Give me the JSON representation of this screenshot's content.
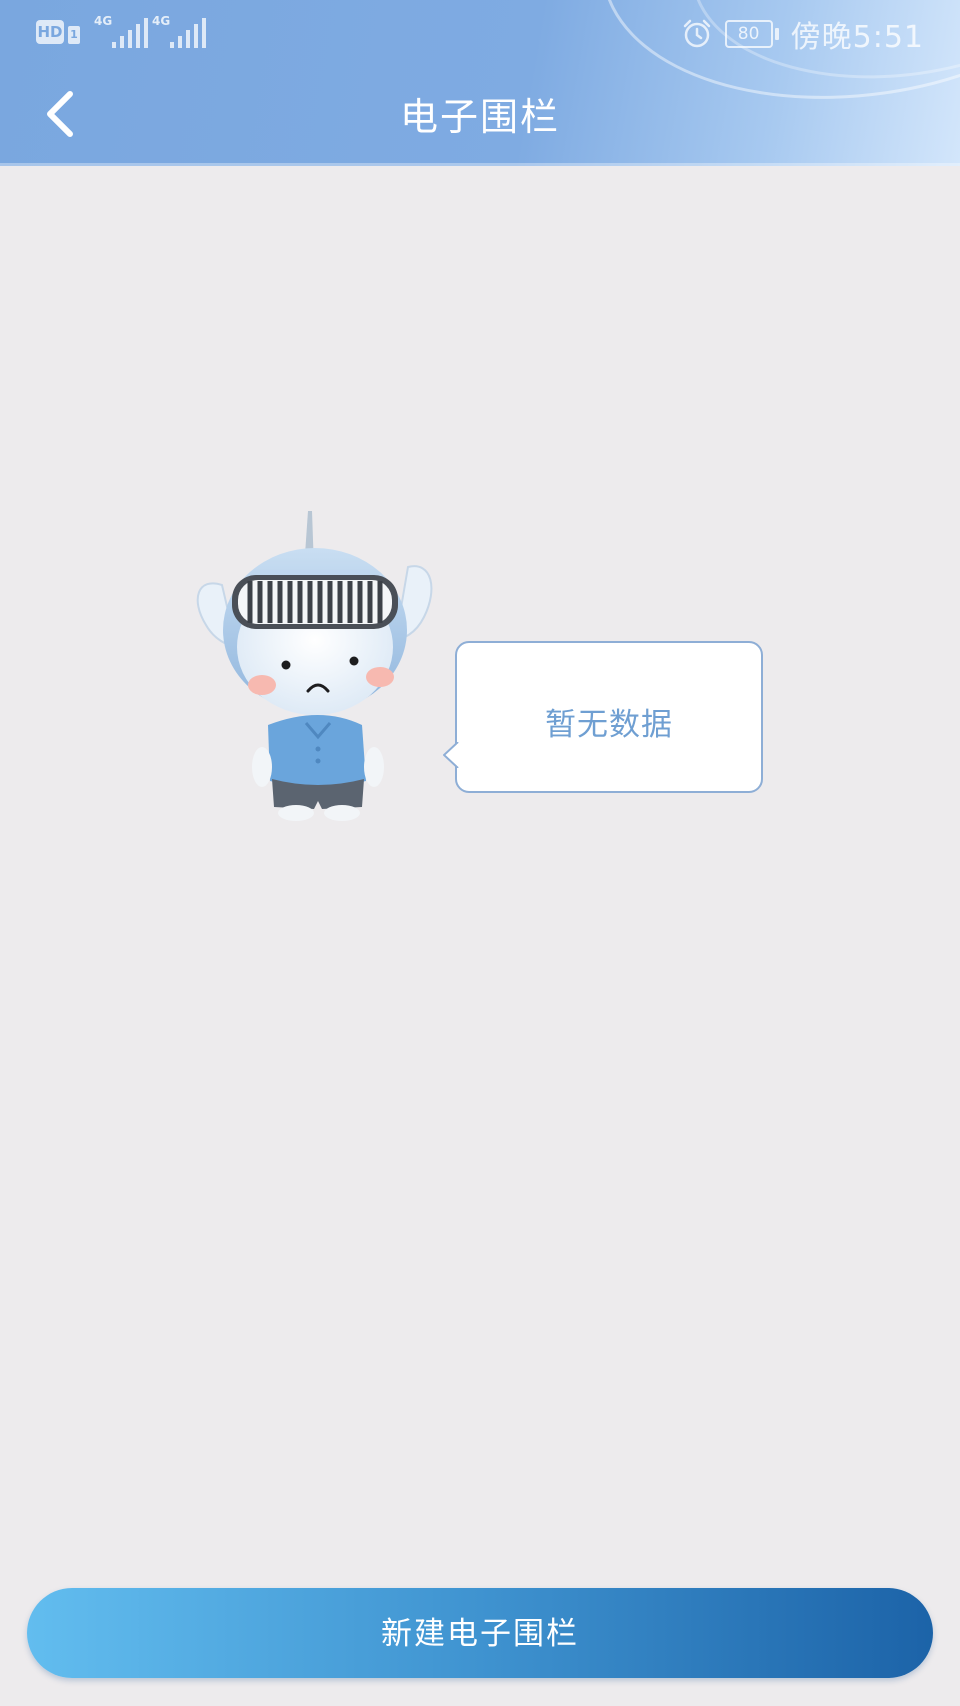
{
  "status_bar": {
    "hd_label": "HD",
    "sim_label": "1",
    "network_1": "4G",
    "network_2": "4G",
    "battery": "80",
    "time": "傍晚5:51"
  },
  "header": {
    "title": "电子围栏"
  },
  "empty_state": {
    "message": "暂无数据"
  },
  "footer": {
    "new_fence_label": "新建电子围栏"
  },
  "colors": {
    "header": "#7fabe2",
    "background": "#edebed",
    "accent": "#3f93d0",
    "bubble_text": "#6f9fd2"
  }
}
